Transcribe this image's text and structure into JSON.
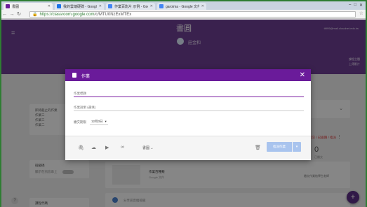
{
  "browser": {
    "tabs": [
      {
        "label": "書圓",
        "color": "#6a1b9a",
        "active": true
      },
      {
        "label": "我的雲端硬碟 - Google 雲端",
        "color": "#1a73e8",
        "active": false
      },
      {
        "label": "作業百影片 示例 - Google",
        "color": "#4285f4",
        "active": false
      },
      {
        "label": "garoima - Google 文件",
        "color": "#4285f4",
        "active": false
      }
    ],
    "url_host": "https://classroom.google.com",
    "url_path": "/c/MTU0NzExMTEx"
  },
  "header": {
    "class_title": "書圓",
    "teacher_name": "莊金和",
    "account": "tt999@mail.cloudnet.edu.tw",
    "links": [
      "課程主題",
      "上傳影片"
    ]
  },
  "left_cards": {
    "upcoming_title": "即將截止的作業",
    "upcoming_items": [
      "作業三",
      "作業三",
      "作業二"
    ],
    "class_code_title": "班級碼",
    "stream_label": "顯示在訊息串上",
    "bottom_label": "課程代碼"
  },
  "right_panel": {
    "doc_title": "作業百種類",
    "doc_sub": "Google 文件",
    "doc_right": "繳交作業給學生老師",
    "stream_placeholder": "分享訊息給班級",
    "count": "0",
    "count_label": "已繳交",
    "red_note": "已交 / 已逾期 / 指派"
  },
  "dialog": {
    "title": "作業",
    "title_placeholder": "作業標題",
    "desc_placeholder": "作業說明 (選填)",
    "due_label": "繳交期限",
    "due_value": "12月3日",
    "topic_label": "書圓",
    "assign_label": "指派作業"
  }
}
